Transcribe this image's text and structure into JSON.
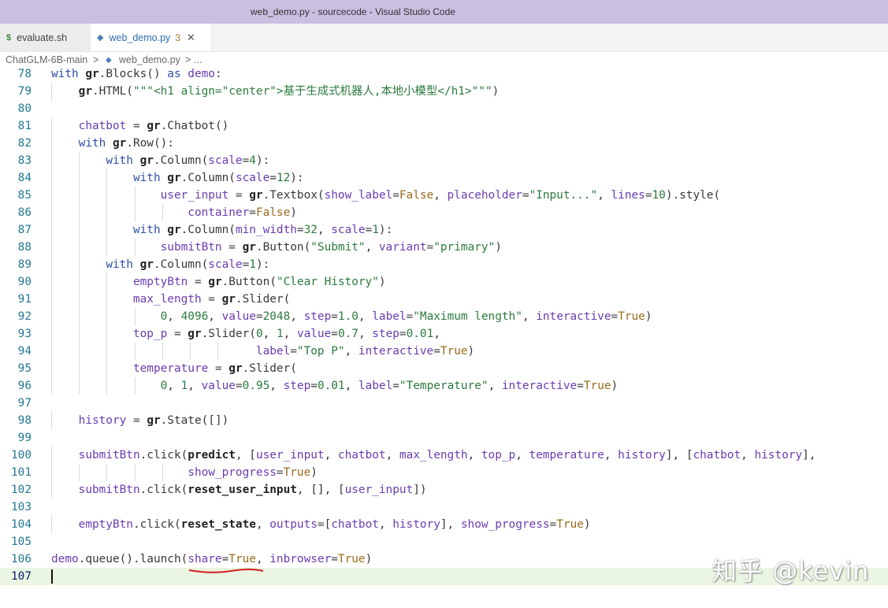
{
  "window": {
    "title": "web_demo.py - sourcecode - Visual Studio Code"
  },
  "tabs": [
    {
      "icon": "$",
      "label": "evaluate.sh"
    },
    {
      "icon": "◆",
      "label": "web_demo.py",
      "badge": "3",
      "close": "✕"
    }
  ],
  "breadcrumb": {
    "folder": "ChatGLM-6B-main",
    "sep": ">",
    "file": "web_demo.py",
    "sep2": ">",
    "ellipsis": "..."
  },
  "editor": {
    "lines": [
      {
        "n": "78",
        "t": "with gr.Blocks() as demo:"
      },
      {
        "n": "79",
        "t": "    gr.HTML(\"\"\"<h1 align=\"center\">基于生成式机器人,本地小模型</h1>\"\"\")"
      },
      {
        "n": "80",
        "t": ""
      },
      {
        "n": "81",
        "t": "    chatbot = gr.Chatbot()"
      },
      {
        "n": "82",
        "t": "    with gr.Row():"
      },
      {
        "n": "83",
        "t": "        with gr.Column(scale=4):"
      },
      {
        "n": "84",
        "t": "            with gr.Column(scale=12):"
      },
      {
        "n": "85",
        "t": "                user_input = gr.Textbox(show_label=False, placeholder=\"Input...\", lines=10).style("
      },
      {
        "n": "86",
        "t": "                    container=False)"
      },
      {
        "n": "87",
        "t": "            with gr.Column(min_width=32, scale=1):"
      },
      {
        "n": "88",
        "t": "                submitBtn = gr.Button(\"Submit\", variant=\"primary\")"
      },
      {
        "n": "89",
        "t": "        with gr.Column(scale=1):"
      },
      {
        "n": "90",
        "t": "            emptyBtn = gr.Button(\"Clear History\")"
      },
      {
        "n": "91",
        "t": "            max_length = gr.Slider("
      },
      {
        "n": "92",
        "t": "                0, 4096, value=2048, step=1.0, label=\"Maximum length\", interactive=True)"
      },
      {
        "n": "93",
        "t": "            top_p = gr.Slider(0, 1, value=0.7, step=0.01,"
      },
      {
        "n": "94",
        "t": "                              label=\"Top P\", interactive=True)"
      },
      {
        "n": "95",
        "t": "            temperature = gr.Slider("
      },
      {
        "n": "96",
        "t": "                0, 1, value=0.95, step=0.01, label=\"Temperature\", interactive=True)"
      },
      {
        "n": "97",
        "t": ""
      },
      {
        "n": "98",
        "t": "    history = gr.State([])"
      },
      {
        "n": "99",
        "t": ""
      },
      {
        "n": "100",
        "t": "    submitBtn.click(predict, [user_input, chatbot, max_length, top_p, temperature, history], [chatbot, history],"
      },
      {
        "n": "101",
        "t": "                    show_progress=True)"
      },
      {
        "n": "102",
        "t": "    submitBtn.click(reset_user_input, [], [user_input])"
      },
      {
        "n": "103",
        "t": ""
      },
      {
        "n": "104",
        "t": "    emptyBtn.click(reset_state, outputs=[chatbot, history], show_progress=True)"
      },
      {
        "n": "105",
        "t": ""
      },
      {
        "n": "106",
        "t": "demo.queue().launch(share=True, inbrowser=True)"
      },
      {
        "n": "107",
        "t": ""
      }
    ],
    "current_line": "107"
  },
  "watermark": "知乎 @kevin"
}
